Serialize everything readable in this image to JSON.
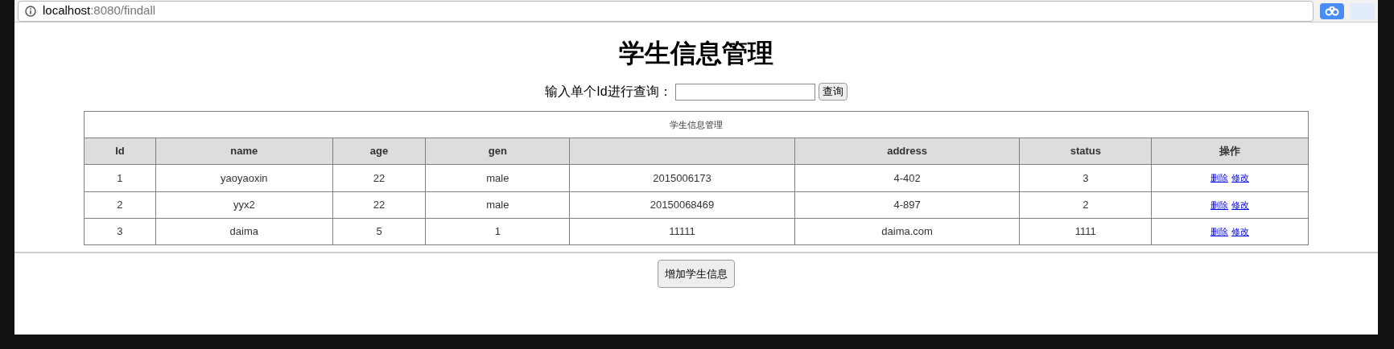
{
  "address_bar": {
    "host": "localhost",
    "path": ":8080/findall"
  },
  "title": "学生信息管理",
  "search": {
    "label": "输入单个Id进行查询：",
    "button": "查询"
  },
  "table": {
    "caption": "学生信息管理",
    "columns": [
      "Id",
      "name",
      "age",
      "gen",
      "",
      "address",
      "status",
      "操作"
    ],
    "rows": [
      {
        "cells": [
          "1",
          "yaoyaoxin",
          "22",
          "male",
          "2015006173",
          "4-402",
          "3"
        ],
        "actions": [
          "删除",
          "修改"
        ]
      },
      {
        "cells": [
          "2",
          "yyx2",
          "22",
          "male",
          "20150068469",
          "4-897",
          "2"
        ],
        "actions": [
          "删除",
          "修改"
        ]
      },
      {
        "cells": [
          "3",
          "daima",
          "5",
          "1",
          "11111",
          "daima.com",
          "1111"
        ],
        "actions": [
          "删除",
          "修改"
        ]
      }
    ]
  },
  "add_button": "增加学生信息"
}
